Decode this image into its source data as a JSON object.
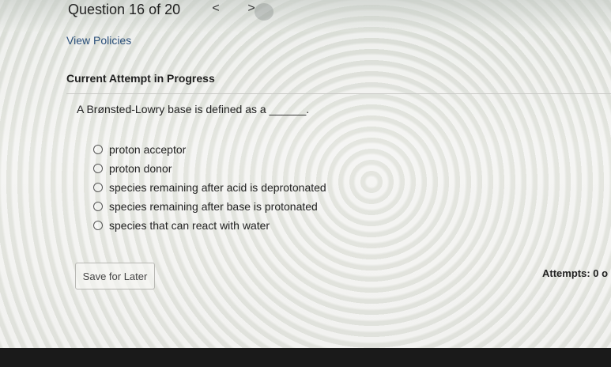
{
  "header": {
    "question_counter": "Question 16 of 20",
    "prev_label": "<",
    "next_label": ">"
  },
  "links": {
    "view_policies": "View Policies"
  },
  "attempt": {
    "title": "Current Attempt in Progress"
  },
  "question": {
    "text": "A Brønsted-Lowry base is defined as a ______.",
    "options": [
      {
        "label": "proton acceptor"
      },
      {
        "label": "proton donor"
      },
      {
        "label": "species remaining after acid is deprotonated"
      },
      {
        "label": "species remaining after base is protonated"
      },
      {
        "label": "species that can react with water"
      }
    ]
  },
  "footer": {
    "save_label": "Save for Later",
    "attempts_text": "Attempts: 0 o"
  }
}
